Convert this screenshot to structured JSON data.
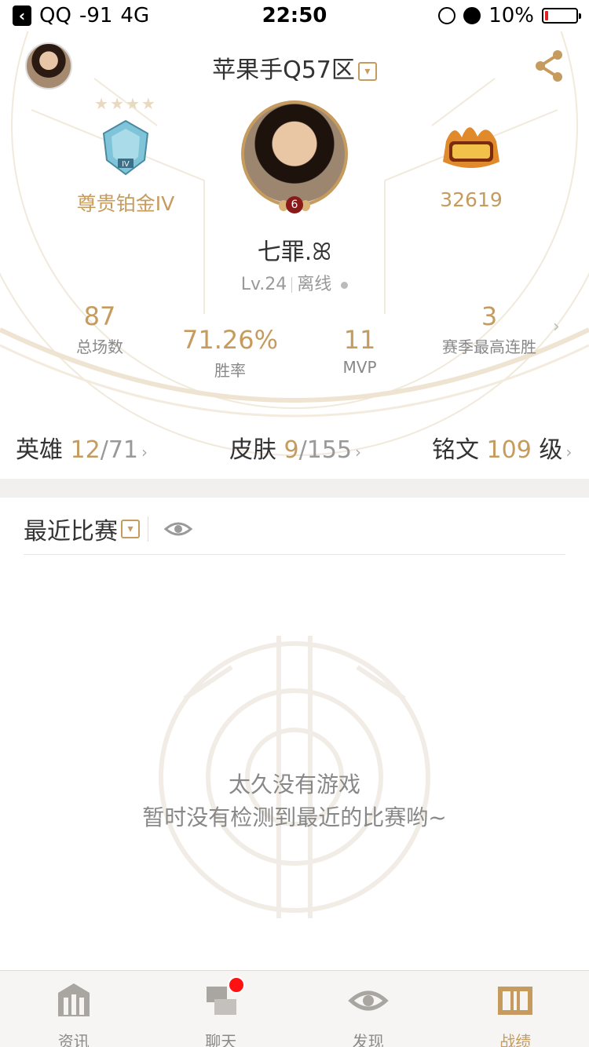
{
  "status_bar": {
    "back_app": "QQ",
    "signal": "-91",
    "network": "4G",
    "time": "22:50",
    "battery": "10%",
    "battery_level": 0.1,
    "battery_color": "#e22222"
  },
  "header": {
    "server": "苹果手Q57区",
    "rank_name": "尊贵铂金IV",
    "rank_stars": "★★★★",
    "power_value": "32619",
    "level_badge": "6",
    "nickname": "七罪.ꕤ",
    "level": "Lv.24",
    "status": "离线"
  },
  "stats": {
    "matches_value": "87",
    "matches_label": "总场数",
    "winrate_value": "71.26%",
    "winrate_label": "胜率",
    "mvp_value": "11",
    "mvp_label": "MVP",
    "streak_value": "3",
    "streak_label": "赛季最高连胜"
  },
  "collection": {
    "heroes_label": "英雄",
    "heroes_owned": "12",
    "heroes_total": "/71",
    "skins_label": "皮肤",
    "skins_owned": "9",
    "skins_total": "/155",
    "runes_label": "铭文",
    "runes_value": "109",
    "runes_unit": "级"
  },
  "recent": {
    "title": "最近比赛",
    "empty_title": "太久没有游戏",
    "empty_subtitle": "暂时没有检测到最近的比赛哟~"
  },
  "tabs": [
    {
      "label": "资讯",
      "icon": "news-icon"
    },
    {
      "label": "聊天",
      "icon": "chat-icon"
    },
    {
      "label": "发现",
      "icon": "discover-eye-icon"
    },
    {
      "label": "战绩",
      "icon": "record-icon"
    }
  ],
  "colors": {
    "accent": "#c69b5e",
    "text": "#333333",
    "muted": "#888888",
    "notification": "#ff1111"
  }
}
